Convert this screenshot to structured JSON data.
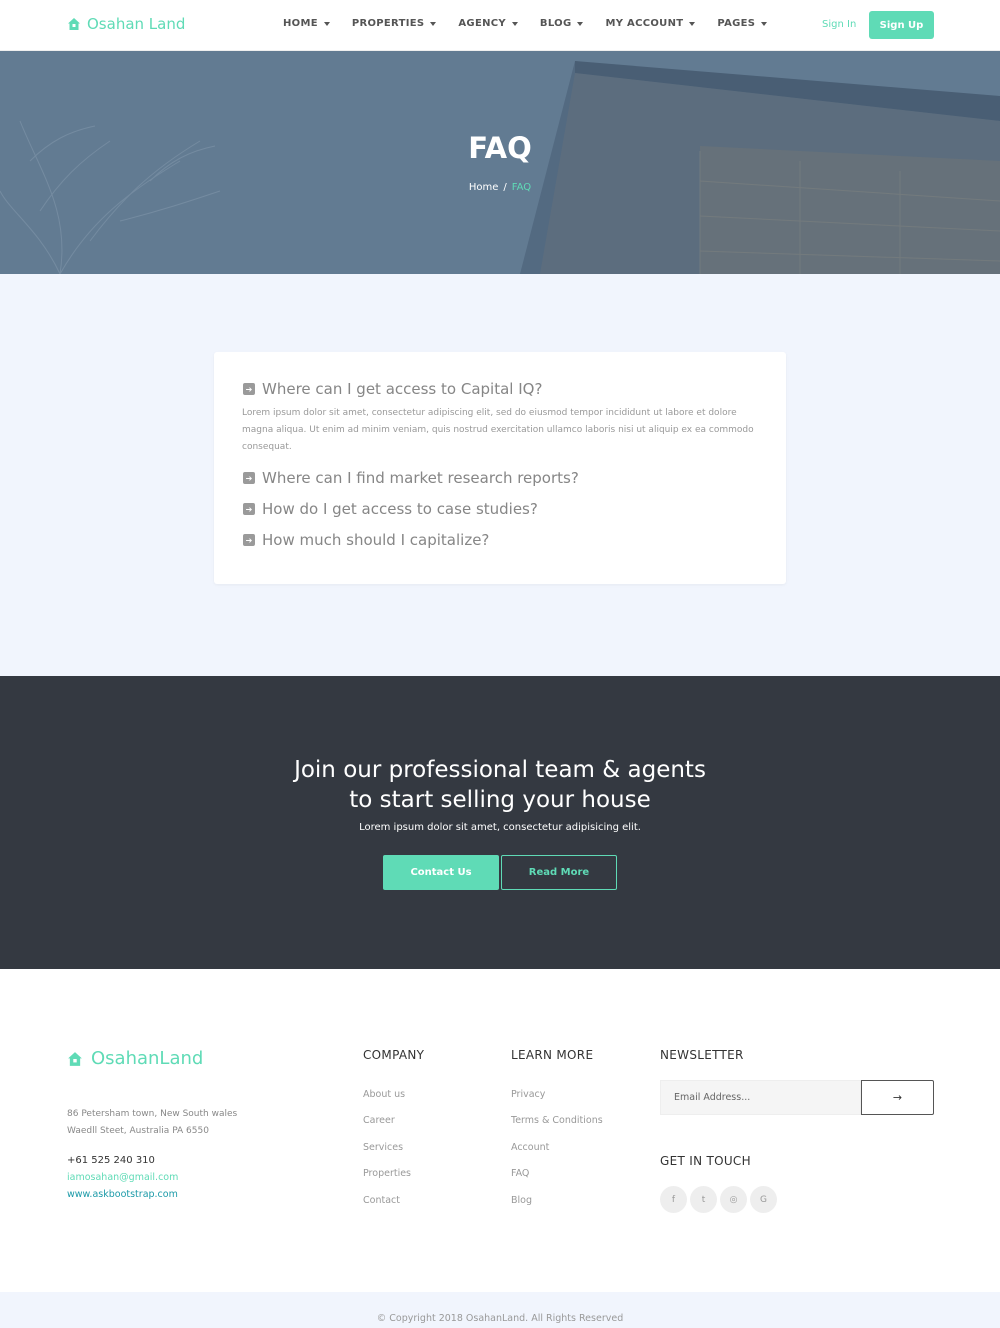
{
  "nav": {
    "brand": "Osahan Land",
    "menu": [
      {
        "label": "HOME"
      },
      {
        "label": "PROPERTIES"
      },
      {
        "label": "AGENCY"
      },
      {
        "label": "BLOG"
      },
      {
        "label": "MY ACCOUNT"
      },
      {
        "label": "PAGES"
      }
    ],
    "signin": "Sign In",
    "signup": "Sign Up"
  },
  "hero": {
    "title": "FAQ",
    "breadcrumb_home": "Home",
    "breadcrumb_sep": "/",
    "breadcrumb_current": "FAQ"
  },
  "faq": {
    "items": [
      {
        "question": "Where can I get access to Capital IQ?",
        "answer": "Lorem ipsum dolor sit amet, consectetur adipiscing elit, sed do eiusmod tempor incididunt ut labore et dolore magna aliqua. Ut enim ad minim veniam, quis nostrud exercitation ullamco laboris nisi ut aliquip ex ea commodo consequat."
      },
      {
        "question": "Where can I find market research reports?"
      },
      {
        "question": "How do I get access to case studies?"
      },
      {
        "question": "How much should I capitalize?"
      }
    ]
  },
  "cta": {
    "title_line1": "Join our professional team & agents",
    "title_line2": "to start selling your house",
    "text": "Lorem ipsum dolor sit amet, consectetur adipisicing elit.",
    "contact_label": "Contact Us",
    "read_label": "Read More"
  },
  "footer": {
    "brand": "OsahanLand",
    "address_line1": "86 Petersham town, New South wales",
    "address_line2": "Waedll Steet, Australia PA 6550",
    "phone": "+61 525 240 310",
    "email": "iamosahan@gmail.com",
    "website": "www.askbootstrap.com",
    "company_title": "COMPANY",
    "company_links": [
      "About us",
      "Career",
      "Services",
      "Properties",
      "Contact"
    ],
    "learn_title": "LEARN MORE",
    "learn_links": [
      "Privacy",
      "Terms & Conditions",
      "Account",
      "FAQ",
      "Blog"
    ],
    "newsletter_title": "NEWSLETTER",
    "newsletter_placeholder": "Email Address...",
    "newsletter_button_icon": "arrow-right-icon",
    "touch_title": "GET IN TOUCH",
    "social": [
      {
        "icon": "facebook-icon",
        "glyph": "f"
      },
      {
        "icon": "twitter-icon",
        "glyph": "t"
      },
      {
        "icon": "instagram-icon",
        "glyph": "◎"
      },
      {
        "icon": "google-icon",
        "glyph": "G"
      }
    ],
    "copyright": "© Copyright 2018 OsahanLand. All Rights Reserved"
  },
  "colors": {
    "accent": "#5fdbb6",
    "hero_overlay": "#62798f",
    "faq_bg": "#f1f5fd",
    "cta_bg": "#343941",
    "link_teal": "#1b9aa8"
  }
}
